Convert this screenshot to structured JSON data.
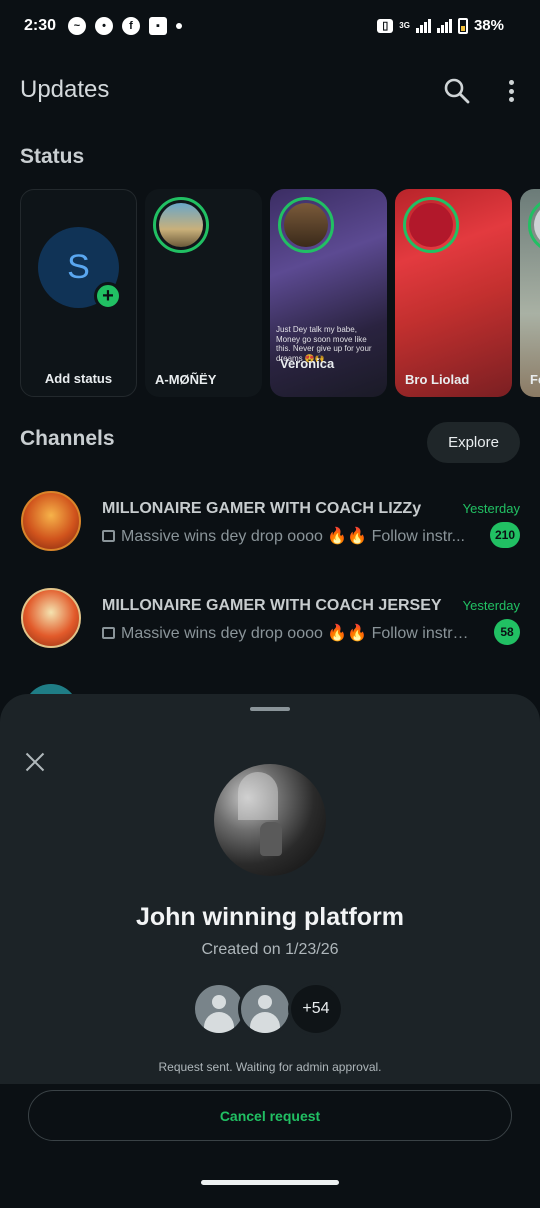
{
  "status_bar": {
    "time": "2:30",
    "network": "3G",
    "battery_percent": "38%"
  },
  "header": {
    "title": "Updates",
    "search_icon": "search-icon",
    "menu_icon": "more-vert-icon"
  },
  "status": {
    "section_title": "Status",
    "add": {
      "avatar_letter": "S",
      "label": "Add status"
    },
    "items": [
      {
        "name": "A-MØÑËY"
      },
      {
        "name": "Veronica",
        "overlay": "Just Dey talk my babe, Money go soon move like this. Never give up for your dreams 😍🙌"
      },
      {
        "name": "Bro Liolad",
        "overlay": "Bro Liolad"
      },
      {
        "name": "Fe"
      }
    ]
  },
  "channels": {
    "section_title": "Channels",
    "explore_label": "Explore",
    "items": [
      {
        "name": "MILLONAIRE GAMER WITH COACH LIZZy",
        "time": "Yesterday",
        "preview": "Massive wins dey drop oooo 🔥🔥  Follow instr...",
        "unread": "210"
      },
      {
        "name": "MILLONAIRE GAMER WITH COACH JERSEY",
        "time": "Yesterday",
        "preview": "Massive wins dey drop oooo 🔥🔥  Follow instru...",
        "unread": "58"
      }
    ]
  },
  "sheet": {
    "title": "John winning platform",
    "created": "Created on 1/23/26",
    "member_count": "+54",
    "note": "Request sent. Waiting for admin approval.",
    "cancel_label": "Cancel request"
  },
  "colors": {
    "background": "#0b1014",
    "accent_green": "#21c063",
    "sheet_background": "#1c2327"
  }
}
